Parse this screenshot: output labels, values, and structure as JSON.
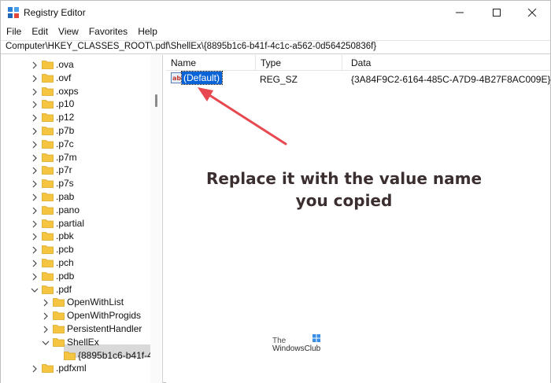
{
  "window": {
    "title": "Registry Editor"
  },
  "menu": [
    "File",
    "Edit",
    "View",
    "Favorites",
    "Help"
  ],
  "address": "Computer\\HKEY_CLASSES_ROOT\\.pdf\\ShellEx\\{8895b1c6-b41f-4c1c-a562-0d564250836f}",
  "tree": [
    {
      "label": ".ova",
      "expanded": false
    },
    {
      "label": ".ovf",
      "expanded": false
    },
    {
      "label": ".oxps",
      "expanded": false
    },
    {
      "label": ".p10",
      "expanded": false
    },
    {
      "label": ".p12",
      "expanded": false
    },
    {
      "label": ".p7b",
      "expanded": false
    },
    {
      "label": ".p7c",
      "expanded": false
    },
    {
      "label": ".p7m",
      "expanded": false
    },
    {
      "label": ".p7r",
      "expanded": false
    },
    {
      "label": ".p7s",
      "expanded": false
    },
    {
      "label": ".pab",
      "expanded": false
    },
    {
      "label": ".pano",
      "expanded": false
    },
    {
      "label": ".partial",
      "expanded": false
    },
    {
      "label": ".pbk",
      "expanded": false
    },
    {
      "label": ".pcb",
      "expanded": false
    },
    {
      "label": ".pch",
      "expanded": false
    },
    {
      "label": ".pdb",
      "expanded": false
    },
    {
      "label": ".pdf",
      "expanded": true
    },
    {
      "label": "OpenWithList",
      "expanded": false
    },
    {
      "label": "OpenWithProgids",
      "expanded": false
    },
    {
      "label": "PersistentHandler",
      "expanded": false
    },
    {
      "label": "ShellEx",
      "expanded": true
    },
    {
      "label": "{8895b1c6-b41f-4",
      "expanded": false
    },
    {
      "label": ".pdfxml",
      "expanded": false
    }
  ],
  "values": {
    "headers": {
      "name": "Name",
      "type": "Type",
      "data": "Data"
    },
    "rows": [
      {
        "name": "(Default)",
        "type": "REG_SZ",
        "data": "{3A84F9C2-6164-485C-A7D9-4B27F8AC009E}"
      }
    ]
  },
  "annotation": {
    "line1": "Replace it with the value name",
    "line2": "you copied"
  },
  "watermark": {
    "line1": "The",
    "line2": "WindowsClub"
  },
  "colors": {
    "selection": "#0a64d8",
    "arrow": "#e8484f",
    "folder": "#f5c542"
  }
}
